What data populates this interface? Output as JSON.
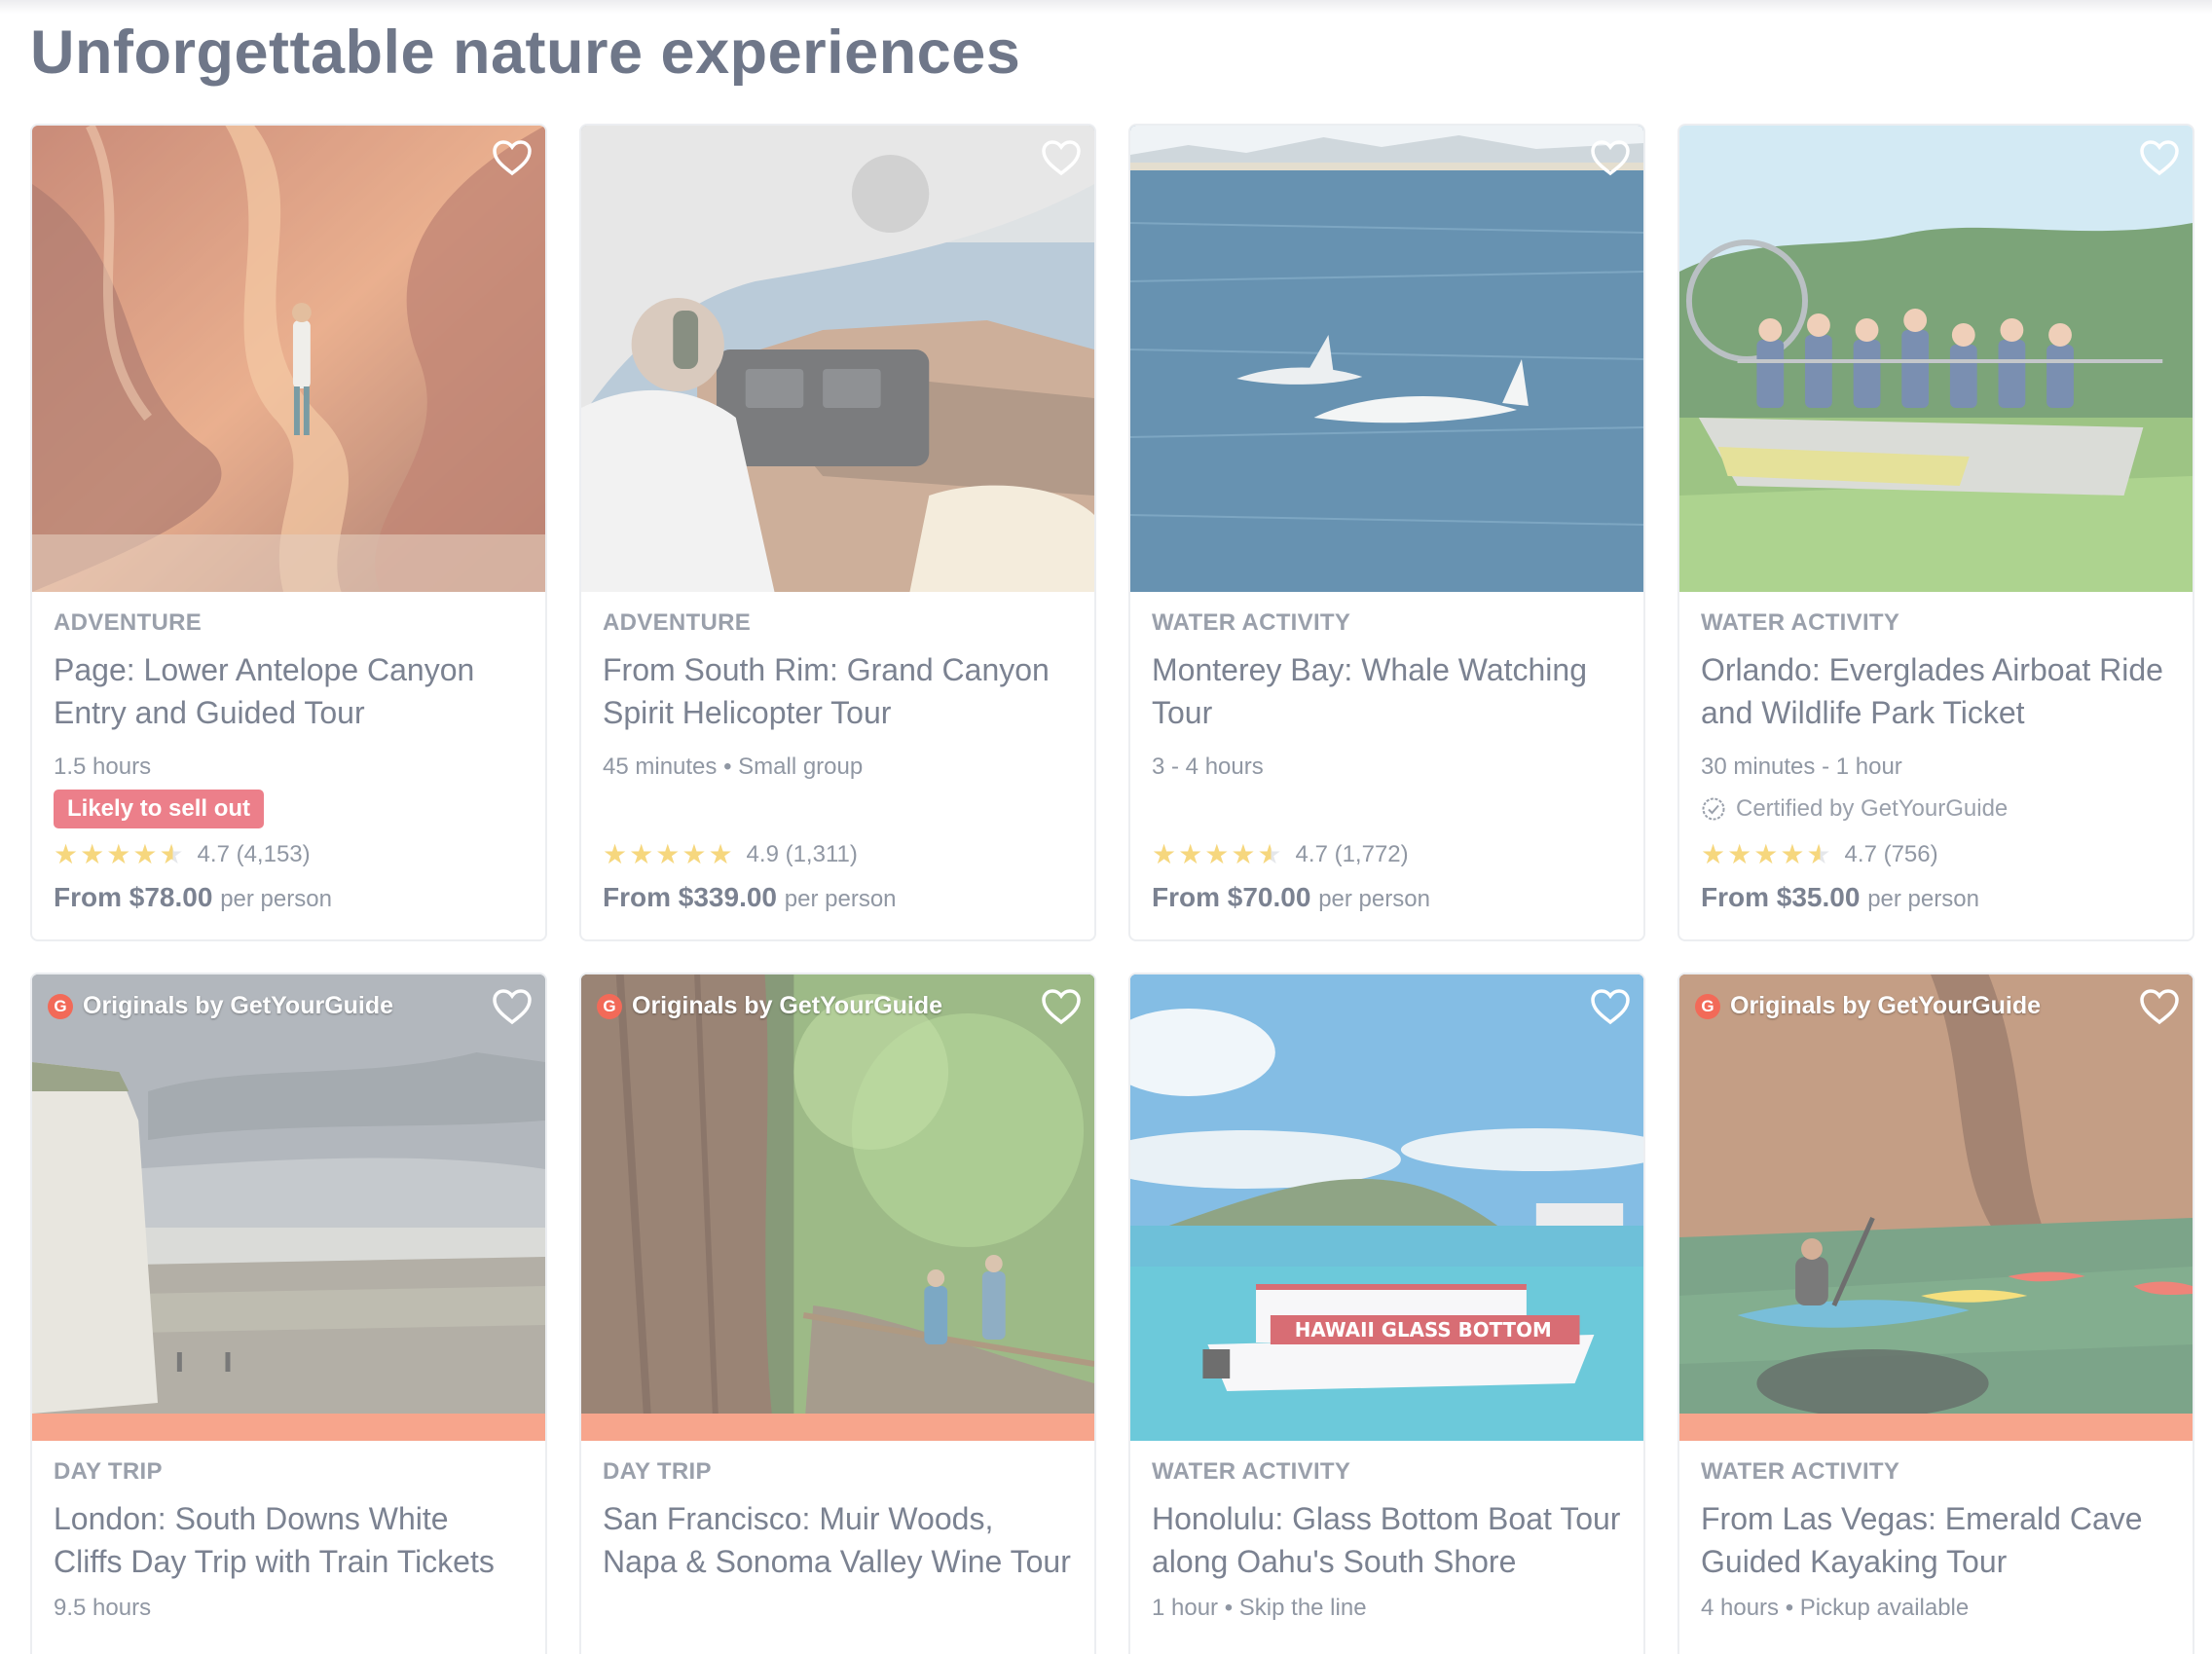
{
  "section_title": "Unforgettable nature experiences",
  "icons": {
    "wishlist": "heart-outline-icon",
    "star": "star-icon",
    "certified": "check-badge-icon",
    "originals": "getyourguide-g-icon"
  },
  "colors": {
    "badge": "#ec7f8a",
    "stars": "#f6d77e",
    "originals_bar": "#f7a58c",
    "originals_logo": "#f26a58"
  },
  "row1": [
    {
      "category": "ADVENTURE",
      "title": "Page: Lower Antelope Canyon Entry and Guided Tour",
      "meta": "1.5 hours",
      "badge": "Likely to sell out",
      "rating": "4.7",
      "reviews": "(4,153)",
      "price": "From $78.00",
      "per": "per person"
    },
    {
      "category": "ADVENTURE",
      "title": "From South Rim: Grand Canyon Spirit Helicopter Tour",
      "meta": "45 minutes • Small group",
      "rating": "4.9",
      "reviews": "(1,311)",
      "price": "From $339.00",
      "per": "per person"
    },
    {
      "category": "WATER ACTIVITY",
      "title": "Monterey Bay: Whale Watching Tour",
      "meta": "3 - 4 hours",
      "rating": "4.7",
      "reviews": "(1,772)",
      "price": "From $70.00",
      "per": "per person"
    },
    {
      "category": "WATER ACTIVITY",
      "title": "Orlando: Everglades Airboat Ride and Wildlife Park Ticket",
      "meta": "30 minutes - 1 hour",
      "certified": "Certified by GetYourGuide",
      "rating": "4.7",
      "reviews": "(756)",
      "price": "From $35.00",
      "per": "per person"
    }
  ],
  "row2": [
    {
      "originals": "Originals by GetYourGuide",
      "category": "DAY TRIP",
      "title": "London: South Downs White Cliffs Day Trip with Train Tickets",
      "meta": "9.5 hours"
    },
    {
      "originals": "Originals by GetYourGuide",
      "category": "DAY TRIP",
      "title": "San Francisco: Muir Woods, Napa & Sonoma Valley Wine Tour",
      "meta": ""
    },
    {
      "category": "WATER ACTIVITY",
      "title": "Honolulu: Glass Bottom Boat Tour along Oahu's South Shore",
      "meta": "1 hour • Skip the line",
      "boat_sign": "HAWAII GLASS BOTTOM"
    },
    {
      "originals": "Originals by GetYourGuide",
      "category": "WATER ACTIVITY",
      "title": "From Las Vegas: Emerald Cave Guided Kayaking Tour",
      "meta": "4 hours • Pickup available"
    }
  ]
}
